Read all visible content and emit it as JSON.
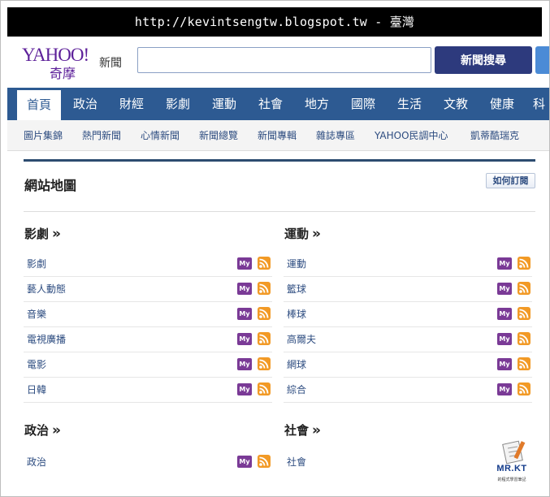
{
  "banner": {
    "text": "http://kevintsengtw.blogspot.tw - 臺灣"
  },
  "logo": {
    "brand": "YAHOO!",
    "brand_local": "奇摩",
    "section": "新聞"
  },
  "search": {
    "value": "",
    "button_label": "新聞搜尋"
  },
  "nav": {
    "tabs": [
      {
        "label": "首頁",
        "active": true
      },
      {
        "label": "政治",
        "active": false
      },
      {
        "label": "財經",
        "active": false
      },
      {
        "label": "影劇",
        "active": false
      },
      {
        "label": "運動",
        "active": false
      },
      {
        "label": "社會",
        "active": false
      },
      {
        "label": "地方",
        "active": false
      },
      {
        "label": "國際",
        "active": false
      },
      {
        "label": "生活",
        "active": false
      },
      {
        "label": "文教",
        "active": false
      },
      {
        "label": "健康",
        "active": false
      },
      {
        "label": "科",
        "active": false
      }
    ]
  },
  "subnav": {
    "items": [
      "圖片集錦",
      "熱門新聞",
      "心情新聞",
      "新聞總覽",
      "新聞專輯",
      "雜誌專區",
      "YAHOO民調中心",
      "凱蒂酷瑞克"
    ]
  },
  "page": {
    "title": "網站地圖",
    "subscribe_label": "如何訂閱"
  },
  "sections": [
    {
      "name": "影劇",
      "raquo": "»",
      "items": [
        "影劇",
        "藝人動態",
        "音樂",
        "電視廣播",
        "電影",
        "日韓"
      ]
    },
    {
      "name": "運動",
      "raquo": "»",
      "items": [
        "運動",
        "籃球",
        "棒球",
        "高爾夫",
        "網球",
        "綜合"
      ]
    },
    {
      "name": "政治",
      "raquo": "»",
      "items": [
        "政治"
      ]
    },
    {
      "name": "社會",
      "raquo": "»",
      "items": [
        "社會"
      ]
    }
  ],
  "icons": {
    "my_label": "My",
    "my_color": "#7a3a96",
    "rss_color": "#f29a26"
  },
  "watermark": {
    "title": "MR.KT",
    "subtitle": "的程式學習筆記"
  },
  "colors": {
    "nav_bg": "#2d5a92",
    "search_button": "#2d3a7d",
    "link": "#2d4c80",
    "brand": "#5c1f99"
  }
}
